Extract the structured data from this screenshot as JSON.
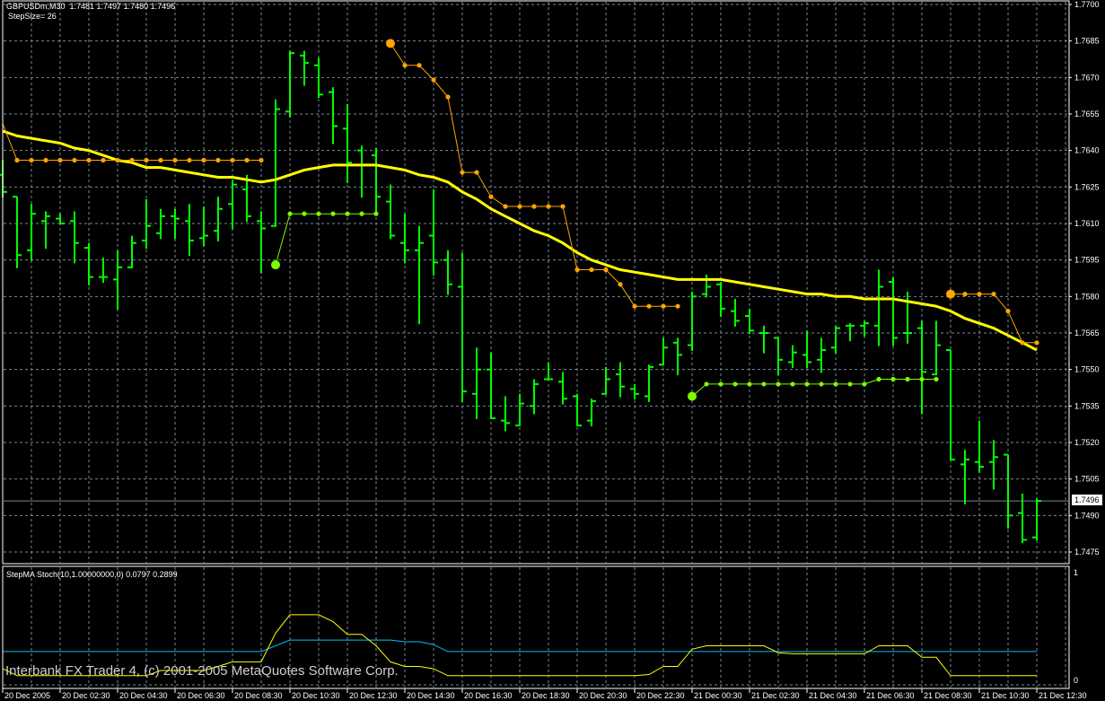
{
  "header": {
    "symbol_line": "GBPUSDm,M30  1.7481 1.7497 1.7480 1.7496",
    "step_size": "StepSize= 26"
  },
  "subwindow": {
    "title": "StepMA Stoch(10,1.00000000,0) 0.0797 0.2899",
    "axis_top": "1",
    "axis_bottom": "0"
  },
  "copyright": "Interbank FX Trader 4, (c) 2001-2005 MetaQuotes Software Corp.",
  "bid": {
    "value": "1.7496",
    "color": "#778899"
  },
  "colors": {
    "bars": "#00ff00",
    "ma": "#ffff00",
    "step_down": "#ffa500",
    "step_up": "#7cfc00",
    "stoch_main": "#ffff00",
    "stoch_signal": "#00bfff",
    "grid": "#778899"
  },
  "chart_data": [
    {
      "type": "ohlc",
      "title": "GBPUSDm,M30",
      "price_labels": [
        "1.7700",
        "1.7685",
        "1.7670",
        "1.7655",
        "1.7640",
        "1.7625",
        "1.7610",
        "1.7595",
        "1.7580",
        "1.7565",
        "1.7550",
        "1.7535",
        "1.7520",
        "1.7505",
        "1.7490",
        "1.7475"
      ],
      "ylim": [
        1.7475,
        1.77
      ],
      "x_labels": [
        "20 Dec 2005",
        "20 Dec 02:30",
        "20 Dec 04:30",
        "20 Dec 06:30",
        "20 Dec 08:30",
        "20 Dec 10:30",
        "20 Dec 12:30",
        "20 Dec 14:30",
        "20 Dec 16:30",
        "20 Dec 18:30",
        "20 Dec 20:30",
        "20 Dec 22:30",
        "21 Dec 00:30",
        "21 Dec 02:30",
        "21 Dec 04:30",
        "21 Dec 06:30",
        "21 Dec 08:30",
        "21 Dec 10:30",
        "21 Dec 12:30"
      ],
      "x_label_every_bars": 4,
      "grid": true,
      "ohlc": [
        [
          1.763,
          1.7636,
          1.7621,
          1.7623
        ],
        [
          1.7621,
          1.7621,
          1.7592,
          1.7597
        ],
        [
          1.7599,
          1.7618,
          1.7595,
          1.7614
        ],
        [
          1.7611,
          1.7615,
          1.76,
          1.7613
        ],
        [
          1.7612,
          1.7614,
          1.761,
          1.761
        ],
        [
          1.7611,
          1.7615,
          1.7594,
          1.7602
        ],
        [
          1.76,
          1.7602,
          1.7585,
          1.7588
        ],
        [
          1.7588,
          1.7596,
          1.7586,
          1.7588
        ],
        [
          1.7587,
          1.7599,
          1.7575,
          1.7592
        ],
        [
          1.7592,
          1.7605,
          1.7592,
          1.7602
        ],
        [
          1.7603,
          1.762,
          1.76,
          1.7609
        ],
        [
          1.7606,
          1.7616,
          1.7604,
          1.7613
        ],
        [
          1.7613,
          1.7616,
          1.7604,
          1.7612
        ],
        [
          1.7611,
          1.7618,
          1.7597,
          1.7603
        ],
        [
          1.7604,
          1.7617,
          1.7601,
          1.7605
        ],
        [
          1.7607,
          1.7621,
          1.7603,
          1.7616
        ],
        [
          1.7618,
          1.7628,
          1.7608,
          1.7626
        ],
        [
          1.7624,
          1.763,
          1.7611,
          1.7613
        ],
        [
          1.7611,
          1.7615,
          1.759,
          1.7608
        ],
        [
          1.7609,
          1.7661,
          1.7609,
          1.7657
        ],
        [
          1.7656,
          1.7681,
          1.7654,
          1.768
        ],
        [
          1.7679,
          1.7681,
          1.7667,
          1.7676
        ],
        [
          1.7675,
          1.7678,
          1.7662,
          1.7663
        ],
        [
          1.7664,
          1.7666,
          1.7643,
          1.765
        ],
        [
          1.7649,
          1.7659,
          1.7627,
          1.7635
        ],
        [
          1.764,
          1.7642,
          1.7621,
          1.7634
        ],
        [
          1.7638,
          1.7641,
          1.7614,
          1.7621
        ],
        [
          1.7619,
          1.7626,
          1.7604,
          1.7605
        ],
        [
          1.7602,
          1.7614,
          1.7594,
          1.7599
        ],
        [
          1.7599,
          1.7609,
          1.7569,
          1.7602
        ],
        [
          1.7605,
          1.7624,
          1.7589,
          1.7594
        ],
        [
          1.7595,
          1.7599,
          1.7581,
          1.7585
        ],
        [
          1.7584,
          1.7598,
          1.7537,
          1.7541
        ],
        [
          1.754,
          1.7559,
          1.753,
          1.755
        ],
        [
          1.755,
          1.7557,
          1.753,
          1.753
        ],
        [
          1.7529,
          1.7539,
          1.7525,
          1.7528
        ],
        [
          1.7527,
          1.754,
          1.7527,
          1.7536
        ],
        [
          1.7535,
          1.7546,
          1.7532,
          1.7544
        ],
        [
          1.7546,
          1.7553,
          1.7546,
          1.7546
        ],
        [
          1.7545,
          1.7549,
          1.7536,
          1.7538
        ],
        [
          1.7539,
          1.754,
          1.7527,
          1.7527
        ],
        [
          1.7529,
          1.7538,
          1.7527,
          1.7537
        ],
        [
          1.754,
          1.7551,
          1.754,
          1.7546
        ],
        [
          1.7548,
          1.7553,
          1.7539,
          1.7543
        ],
        [
          1.7542,
          1.7544,
          1.7538,
          1.754
        ],
        [
          1.7539,
          1.7552,
          1.7537,
          1.7551
        ],
        [
          1.7552,
          1.7563,
          1.7552,
          1.7559
        ],
        [
          1.7561,
          1.7563,
          1.7548,
          1.7556
        ],
        [
          1.756,
          1.7582,
          1.7558,
          1.758
        ],
        [
          1.7581,
          1.7589,
          1.758,
          1.7584
        ],
        [
          1.7585,
          1.7586,
          1.7572,
          1.7575
        ],
        [
          1.7574,
          1.7579,
          1.7568,
          1.757
        ],
        [
          1.7572,
          1.7575,
          1.7565,
          1.7566
        ],
        [
          1.7565,
          1.7568,
          1.7557,
          1.7565
        ],
        [
          1.7563,
          1.7563,
          1.7548,
          1.7554
        ],
        [
          1.7553,
          1.756,
          1.7551,
          1.7557
        ],
        [
          1.7556,
          1.7566,
          1.7551,
          1.7553
        ],
        [
          1.7554,
          1.7563,
          1.7549,
          1.7558
        ],
        [
          1.7559,
          1.7568,
          1.7557,
          1.7567
        ],
        [
          1.7568,
          1.7569,
          1.7562,
          1.7568
        ],
        [
          1.7568,
          1.757,
          1.7564,
          1.7569
        ],
        [
          1.7568,
          1.7591,
          1.756,
          1.7584
        ],
        [
          1.7586,
          1.7588,
          1.756,
          1.7563
        ],
        [
          1.7565,
          1.7582,
          1.7561,
          1.7565
        ],
        [
          1.7567,
          1.757,
          1.7532,
          1.7549
        ],
        [
          1.7548,
          1.757,
          1.7548,
          1.756
        ],
        [
          1.7558,
          1.7558,
          1.7513,
          1.7513
        ],
        [
          1.7511,
          1.7517,
          1.7495,
          1.7513
        ],
        [
          1.7512,
          1.7529,
          1.7508,
          1.751
        ],
        [
          1.7512,
          1.7521,
          1.7501,
          1.7514
        ],
        [
          1.7515,
          1.7515,
          1.7485,
          1.749
        ],
        [
          1.7491,
          1.7499,
          1.7479,
          1.748
        ],
        [
          1.7481,
          1.7497,
          1.748,
          1.7496
        ]
      ],
      "series": [
        {
          "name": "moving-average",
          "values": [
            1.7648,
            1.7646,
            1.7645,
            1.7644,
            1.7643,
            1.7641,
            1.764,
            1.7638,
            1.7636,
            1.7635,
            1.7633,
            1.7633,
            1.7632,
            1.7631,
            1.763,
            1.7629,
            1.7629,
            1.7628,
            1.7627,
            1.7628,
            1.763,
            1.7632,
            1.7633,
            1.7634,
            1.7634,
            1.7634,
            1.7634,
            1.7633,
            1.7632,
            1.763,
            1.7629,
            1.7627,
            1.7623,
            1.762,
            1.7616,
            1.7613,
            1.761,
            1.7607,
            1.7605,
            1.7602,
            1.7598,
            1.7595,
            1.7593,
            1.7591,
            1.759,
            1.7589,
            1.7588,
            1.7587,
            1.7587,
            1.7587,
            1.7587,
            1.7586,
            1.7585,
            1.7584,
            1.7583,
            1.7582,
            1.7581,
            1.7581,
            1.758,
            1.758,
            1.7579,
            1.7579,
            1.7579,
            1.7578,
            1.7577,
            1.7576,
            1.7574,
            1.7571,
            1.7569,
            1.7567,
            1.7564,
            1.7561,
            1.7558
          ]
        },
        {
          "name": "step-down",
          "big_markers": [
            27,
            66
          ],
          "values": [
            1.7651,
            1.7636,
            1.7636,
            1.7636,
            1.7636,
            1.7636,
            1.7636,
            1.7636,
            1.7636,
            1.7636,
            1.7636,
            1.7636,
            1.7636,
            1.7636,
            1.7636,
            1.7636,
            1.7636,
            1.7636,
            1.7636,
            null,
            null,
            null,
            null,
            null,
            null,
            null,
            null,
            1.7684,
            1.7675,
            1.7675,
            1.7669,
            1.7662,
            1.7631,
            1.7631,
            1.7621,
            1.7617,
            1.7617,
            1.7617,
            1.7617,
            1.7617,
            1.7591,
            1.7591,
            1.7591,
            1.7585,
            1.7576,
            1.7576,
            1.7576,
            1.7576,
            null,
            null,
            null,
            null,
            null,
            null,
            null,
            null,
            null,
            null,
            null,
            null,
            null,
            null,
            null,
            null,
            null,
            null,
            1.7581,
            1.7581,
            1.7581,
            1.7581,
            1.7574,
            1.7561,
            1.7561
          ]
        },
        {
          "name": "step-up",
          "big_markers": [
            19,
            48
          ],
          "values": [
            null,
            null,
            null,
            null,
            null,
            null,
            null,
            null,
            null,
            null,
            null,
            null,
            null,
            null,
            null,
            null,
            null,
            null,
            null,
            1.7593,
            1.7614,
            1.7614,
            1.7614,
            1.7614,
            1.7614,
            1.7614,
            1.7614,
            null,
            null,
            null,
            null,
            null,
            null,
            null,
            null,
            null,
            null,
            null,
            null,
            null,
            null,
            null,
            null,
            null,
            null,
            null,
            null,
            null,
            1.7539,
            1.7544,
            1.7544,
            1.7544,
            1.7544,
            1.7544,
            1.7544,
            1.7544,
            1.7544,
            1.7544,
            1.7544,
            1.7544,
            1.7544,
            1.7546,
            1.7546,
            1.7546,
            1.7546,
            1.7546,
            null,
            null,
            null,
            null,
            null,
            null,
            null
          ]
        }
      ]
    },
    {
      "type": "line",
      "title": "StepMA Stoch(10,1.00000000,0)",
      "ylim": [
        0,
        1
      ],
      "series": [
        {
          "name": "stoch-main",
          "values": [
            0.14,
            0.0797,
            0.0797,
            0.0797,
            0.0797,
            0.0797,
            0.0797,
            0.0797,
            0.0797,
            0.0797,
            0.0797,
            0.125,
            0.125,
            0.125,
            0.125,
            0.16,
            0.2,
            0.2,
            0.2,
            0.45,
            0.61,
            0.61,
            0.61,
            0.55,
            0.44,
            0.44,
            0.34,
            0.2,
            0.16,
            0.16,
            0.14,
            0.0797,
            0.0797,
            0.0797,
            0.0797,
            0.0797,
            0.0797,
            0.0797,
            0.0797,
            0.0797,
            0.0797,
            0.0797,
            0.0797,
            0.0797,
            0.0797,
            0.09,
            0.16,
            0.16,
            0.31,
            0.34,
            0.34,
            0.34,
            0.34,
            0.34,
            0.28,
            0.27,
            0.27,
            0.27,
            0.27,
            0.27,
            0.27,
            0.34,
            0.34,
            0.34,
            0.24,
            0.24,
            0.0797,
            0.0797,
            0.0797,
            0.0797,
            0.0797,
            0.0797,
            0.0797
          ]
        },
        {
          "name": "stoch-signal",
          "values": [
            0.2899,
            0.2899,
            0.2899,
            0.2899,
            0.2899,
            0.2899,
            0.2899,
            0.2899,
            0.2899,
            0.2899,
            0.2899,
            0.2899,
            0.2899,
            0.2899,
            0.2899,
            0.2899,
            0.2899,
            0.2899,
            0.2899,
            0.34,
            0.39,
            0.39,
            0.39,
            0.39,
            0.39,
            0.39,
            0.39,
            0.39,
            0.375,
            0.375,
            0.35,
            0.2899,
            0.2899,
            0.2899,
            0.2899,
            0.2899,
            0.2899,
            0.2899,
            0.2899,
            0.2899,
            0.2899,
            0.2899,
            0.2899,
            0.2899,
            0.2899,
            0.2899,
            0.2899,
            0.2899,
            0.2899,
            0.2899,
            0.2899,
            0.2899,
            0.2899,
            0.2899,
            0.2899,
            0.2899,
            0.2899,
            0.2899,
            0.2899,
            0.2899,
            0.2899,
            0.2899,
            0.2899,
            0.2899,
            0.2899,
            0.2899,
            0.2899,
            0.2899,
            0.2899,
            0.2899,
            0.2899,
            0.2899,
            0.2899
          ]
        }
      ]
    }
  ]
}
